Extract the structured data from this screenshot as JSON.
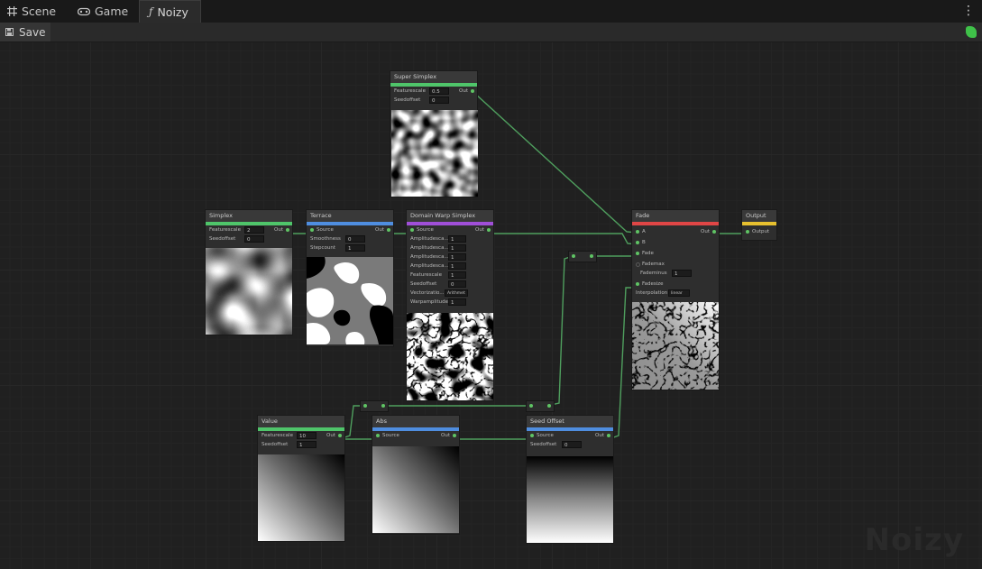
{
  "tabs": [
    {
      "label": "Scene",
      "icon": "grid-icon"
    },
    {
      "label": "Game",
      "icon": "gamepad-icon"
    },
    {
      "label": "Noizy",
      "icon": "function-icon",
      "active": true
    }
  ],
  "menu_icon": "kebab-menu-icon",
  "toolbar": {
    "save_label": "Save",
    "save_icon": "save-icon"
  },
  "status_color": "#3fc149",
  "watermark": "Noizy",
  "colors": {
    "green": "#4fc56a",
    "blue": "#4f8ee0",
    "purple": "#a04fd8",
    "red": "#e04646",
    "yellow": "#e7c02f",
    "wire": "#4f9f5e"
  },
  "nodes": {
    "super_simplex": {
      "title": "Super Simplex",
      "out": "Out",
      "featurescale_label": "Featurescale",
      "featurescale": "0.5",
      "seedoffset_label": "Seedoffset",
      "seedoffset": "0"
    },
    "simplex": {
      "title": "Simplex",
      "out": "Out",
      "featurescale_label": "Featurescale",
      "featurescale": "2",
      "seedoffset_label": "Seedoffset",
      "seedoffset": "0"
    },
    "terrace": {
      "title": "Terrace",
      "out": "Out",
      "source_label": "Source",
      "smoothness_label": "Smoothness",
      "smoothness": "0",
      "stepcount_label": "Stepcount",
      "stepcount": "1"
    },
    "domain_warp": {
      "title": "Domain Warp Simplex",
      "out": "Out",
      "source_label": "Source",
      "rows": [
        {
          "label": "Amplitudesca...",
          "value": "1"
        },
        {
          "label": "Amplitudesca...",
          "value": "1"
        },
        {
          "label": "Amplitudesca...",
          "value": "1"
        },
        {
          "label": "Amplitudesca...",
          "value": "1"
        },
        {
          "label": "Featurescale",
          "value": "1"
        },
        {
          "label": "Seedoffset",
          "value": "0"
        },
        {
          "label": "Vectorizatio...",
          "value": "Arithmet"
        },
        {
          "label": "Warpamplitude",
          "value": "1"
        }
      ]
    },
    "fade": {
      "title": "Fade",
      "out": "Out",
      "a_label": "A",
      "b_label": "B",
      "fade_label": "Fade",
      "falloff_label": "Fademinus",
      "fademax_label": "Fademax",
      "fademax": "1",
      "fadesize_label": "Fadesize",
      "interp_label": "Interpolation",
      "interp": "linear"
    },
    "output": {
      "title": "Output",
      "in_label": "Output"
    },
    "value": {
      "title": "Value",
      "out": "Out",
      "featurescale_label": "Featurescale",
      "featurescale": "10",
      "seedoffset_label": "Seedoffset",
      "seedoffset": "1"
    },
    "abs": {
      "title": "Abs",
      "out": "Out",
      "source_label": "Source"
    },
    "seed_offset": {
      "title": "Seed Offset",
      "out": "Out",
      "source_label": "Source",
      "seedoffset_label": "Seedoffset",
      "seedoffset": "0"
    }
  }
}
